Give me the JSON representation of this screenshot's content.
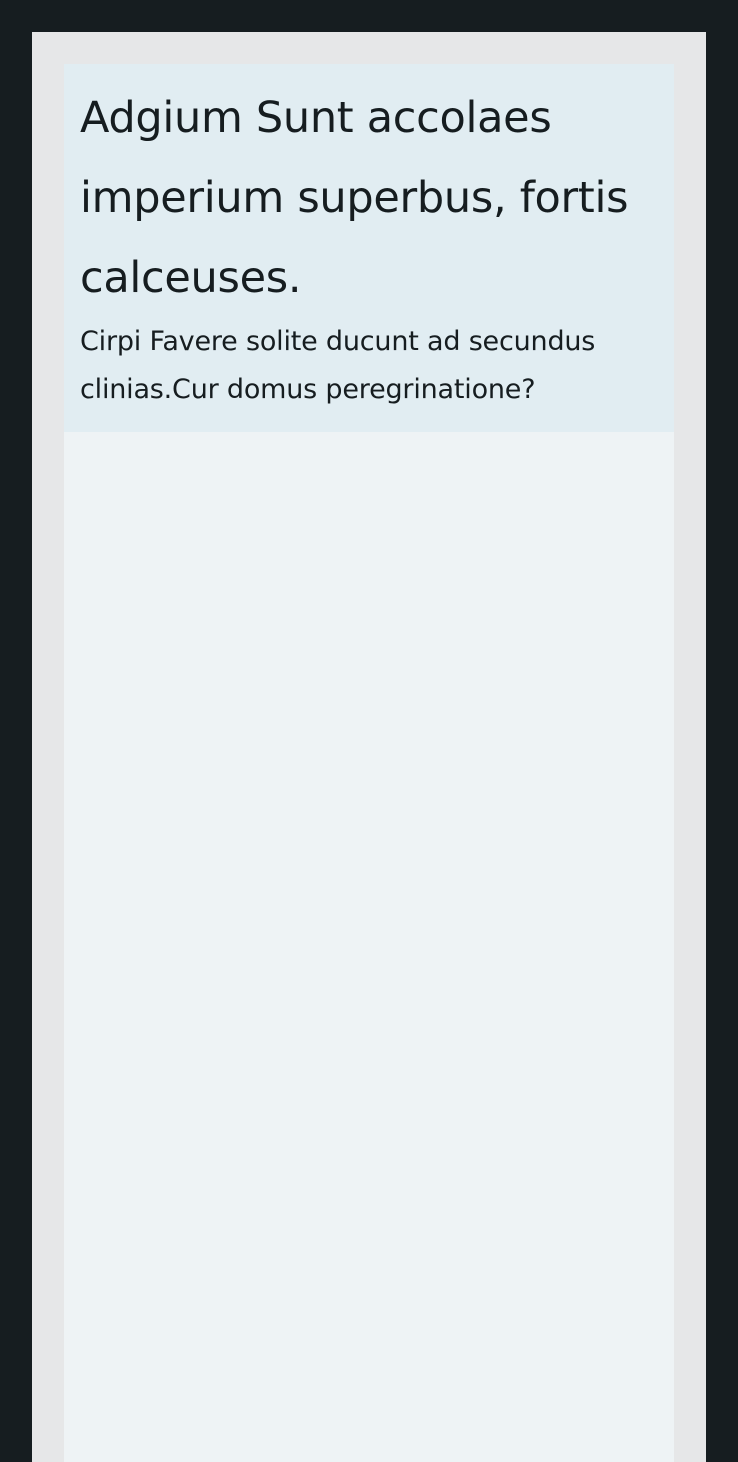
{
  "header": {
    "title": "Adgium Sunt accolaes imperium superbus, fortis calceuses.",
    "subtitle": "Cirpi Favere solite ducunt ad secundus clinias.Cur domus peregrinatione?"
  },
  "colors": {
    "page_background": "#161d20",
    "frame": "#e6e7e8",
    "panel": "#eef3f5",
    "header_card": "#e1edf2",
    "text": "#161d20"
  }
}
